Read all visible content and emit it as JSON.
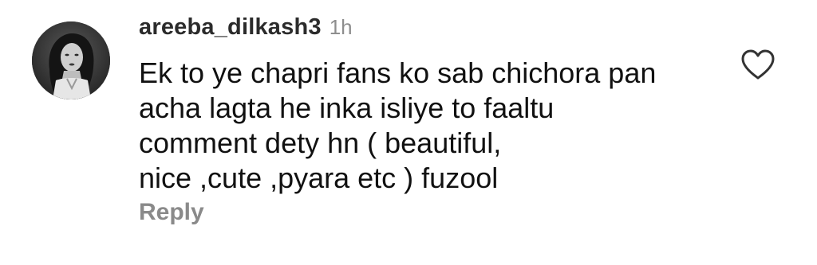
{
  "comment": {
    "username": "areeba_dilkash3",
    "time": "1h",
    "text_lines": [
      "Ek to ye chapri fans ko sab chichora pan",
      "acha lagta he inka isliye to faaltu",
      "comment dety hn ( beautiful,",
      "nice ,cute ,pyara etc ) fuzool"
    ],
    "reply_label": "Reply",
    "like_icon": "heart-outline-icon",
    "avatar_icon": "profile-photo"
  },
  "colors": {
    "username": "#2b2b2b",
    "time": "#8e8e8e",
    "text": "#111111",
    "reply": "#8a8a8a",
    "icon": "#333333"
  }
}
